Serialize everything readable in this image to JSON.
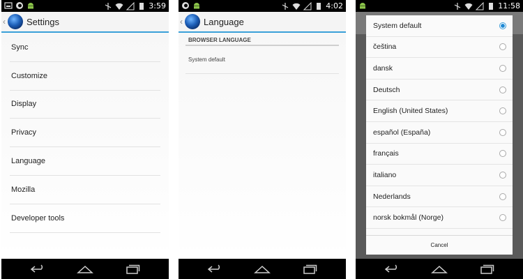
{
  "screen1": {
    "status_time": "3:59",
    "title": "Settings",
    "items": [
      "Sync",
      "Customize",
      "Display",
      "Privacy",
      "Language",
      "Mozilla",
      "Developer tools"
    ]
  },
  "screen2": {
    "status_time": "4:02",
    "title": "Language",
    "section_header": "BROWSER LANGUAGE",
    "language_value": "System default"
  },
  "screen3": {
    "status_time": "11:58",
    "languages": [
      "System default",
      "čeština",
      "dansk",
      "Deutsch",
      "English (United States)",
      "español (España)",
      "français",
      "italiano",
      "Nederlands",
      "norsk bokmål (Norge)"
    ],
    "selected_index": 0,
    "cancel_label": "Cancel"
  },
  "colors": {
    "accent": "#3aa0d8",
    "radio_selected": "#1e88d4",
    "status_bar": "#000000",
    "nav_bar": "#000000"
  },
  "icons": {
    "status_left": [
      "screenshot-icon",
      "firefox-icon",
      "android-icon"
    ],
    "status_right": [
      "no-gps-icon",
      "wifi-icon",
      "signal-icon",
      "battery-icon"
    ],
    "nav": [
      "back-icon",
      "home-icon",
      "recents-icon"
    ]
  }
}
